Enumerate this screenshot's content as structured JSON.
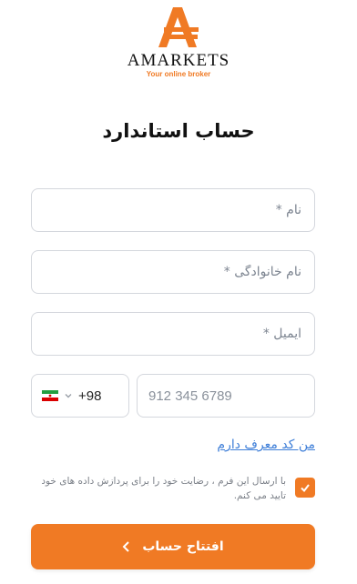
{
  "brand": {
    "name": "AMARKETS",
    "tagline": "Your online broker",
    "accent_color": "#f07a24"
  },
  "form": {
    "title": "حساب استاندارد",
    "first_name_placeholder": "نام *",
    "last_name_placeholder": "نام خانوادگی *",
    "email_placeholder": "ایمیل *",
    "phone": {
      "country_flag": "iran-flag-icon",
      "country_code": "+98",
      "placeholder": "912 345 6789"
    },
    "referral_link": "من کد معرف دارم",
    "consent": {
      "checked": true,
      "text": "با ارسال این فرم ، رضایت خود را برای پردازش داده های خود تایید می کنم."
    },
    "submit_label": "افتتاح حساب"
  }
}
